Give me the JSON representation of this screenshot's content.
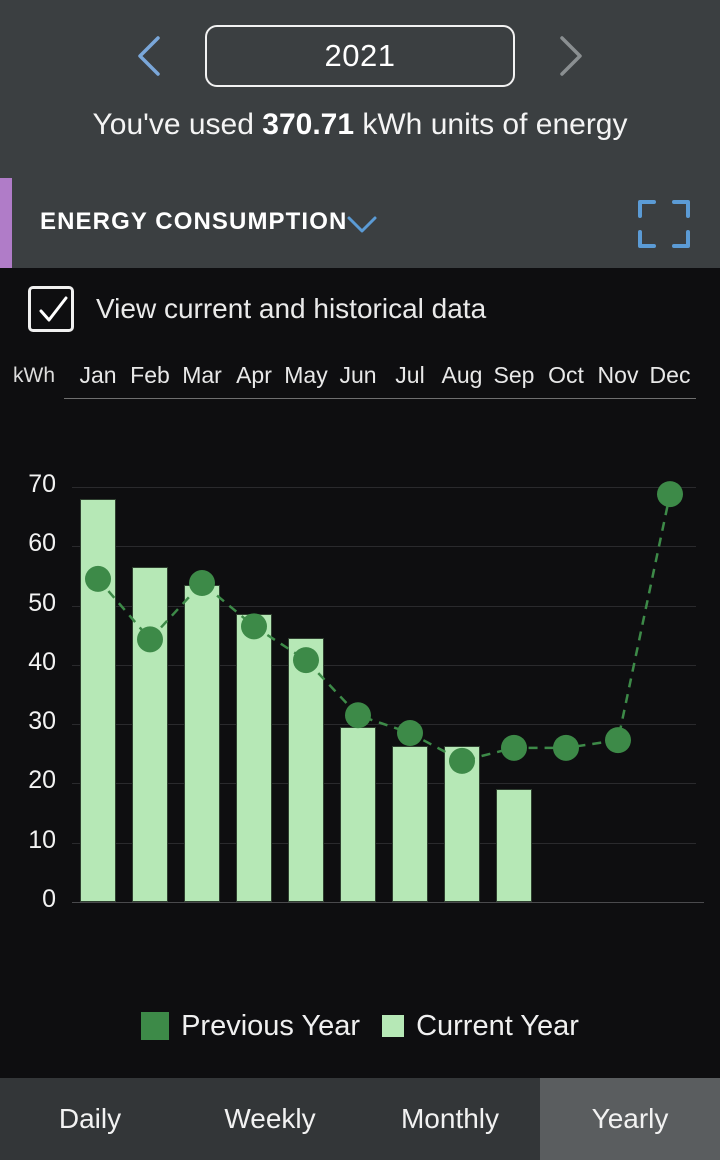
{
  "header": {
    "year": "2021",
    "prev_icon": "chevron-left-icon",
    "next_icon": "chevron-right-icon",
    "prev_color": "#7aa7d9",
    "next_color": "#8a8f91",
    "summary_prefix": "You've used ",
    "summary_value": "370.71",
    "summary_suffix": " kWh units of energy"
  },
  "section": {
    "title": "ENERGY CONSUMPTION",
    "caret_icon": "chevron-down-icon",
    "expand_icon": "expand-fullscreen-icon",
    "accent_color": "#b07cc8",
    "icon_color": "#5b9bd5"
  },
  "options": {
    "historical_label": "View current and historical data",
    "historical_checked": "true",
    "check_icon": "checkmark-icon"
  },
  "legend": {
    "previous_label": "Previous Year",
    "current_label": "Current Year",
    "previous_color": "#3d8a48",
    "current_color": "#b6e8b6"
  },
  "tabs": [
    {
      "label": "Daily",
      "active": "false"
    },
    {
      "label": "Weekly",
      "active": "false"
    },
    {
      "label": "Monthly",
      "active": "false"
    },
    {
      "label": "Yearly",
      "active": "true"
    }
  ],
  "chart_data": {
    "type": "bar",
    "title": "",
    "xlabel": "",
    "ylabel": "kWh",
    "unit_label": "kWh",
    "categories": [
      "Jan",
      "Feb",
      "Mar",
      "Apr",
      "May",
      "Jun",
      "Jul",
      "Aug",
      "Sep",
      "Oct",
      "Nov",
      "Dec"
    ],
    "yticks": [
      70,
      60,
      50,
      40,
      30,
      20,
      10,
      0
    ],
    "ylim": [
      0,
      70
    ],
    "grid": true,
    "legend_position": "bottom",
    "series": [
      {
        "name": "Current Year",
        "type": "bar",
        "color": "#b6e8b6",
        "values": [
          68.0,
          56.5,
          53.5,
          48.5,
          44.5,
          29.5,
          26.3,
          26.3,
          19.0,
          null,
          null,
          null
        ]
      },
      {
        "name": "Previous Year",
        "type": "line",
        "style": "dashed",
        "marker": "circle",
        "color": "#3d8a48",
        "values": [
          54.5,
          44.3,
          53.8,
          46.5,
          40.8,
          31.5,
          28.5,
          23.8,
          26.0,
          26.0,
          27.3,
          68.8
        ]
      }
    ]
  }
}
